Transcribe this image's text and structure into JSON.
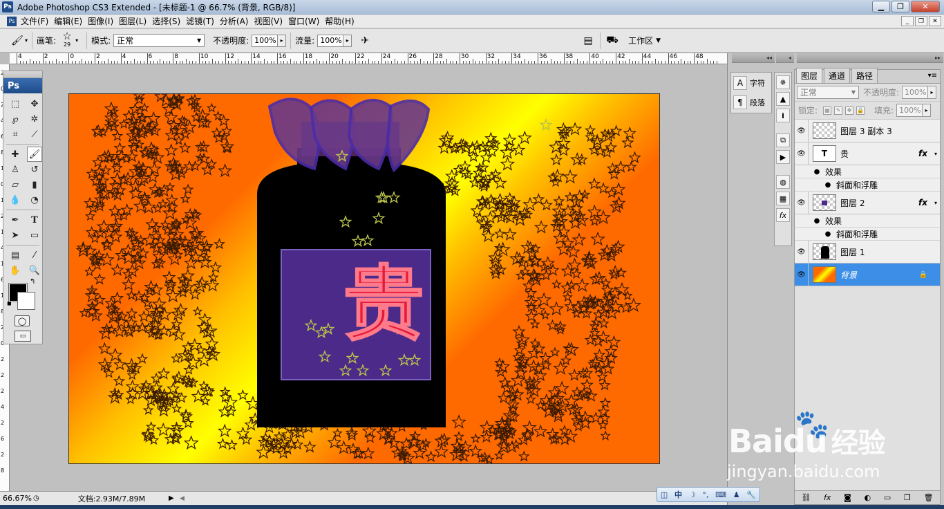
{
  "window": {
    "title": "Adobe Photoshop CS3 Extended - [未标题-1 @ 66.7% (背景, RGB/8)]",
    "app_icon": "Ps"
  },
  "menu": [
    "文件(F)",
    "编辑(E)",
    "图像(I)",
    "图层(L)",
    "选择(S)",
    "滤镜(T)",
    "分析(A)",
    "视图(V)",
    "窗口(W)",
    "帮助(H)"
  ],
  "options": {
    "brush_label": "画笔:",
    "brush_size": "29",
    "mode_label": "模式:",
    "mode_value": "正常",
    "opacity_label": "不透明度:",
    "opacity_value": "100%",
    "flow_label": "流量:",
    "flow_value": "100%",
    "workspace_label": "工作区"
  },
  "ruler": {
    "top_labels": [
      "4",
      "2",
      "0",
      "2",
      "4",
      "6",
      "8",
      "10",
      "12",
      "14",
      "16",
      "18",
      "20",
      "22",
      "24",
      "26",
      "28",
      "30",
      "32",
      "34",
      "36",
      "38",
      "40",
      "42",
      "44",
      "46",
      "48"
    ],
    "left_labels": [
      "2",
      "0",
      "2",
      "4",
      "6",
      "8",
      "1",
      "0",
      "1",
      "2",
      "1",
      "4",
      "1",
      "6",
      "1",
      "8",
      "2",
      "0",
      "2",
      "2",
      "2",
      "4",
      "2",
      "6",
      "2",
      "8"
    ]
  },
  "toolbox": {
    "logo": "Ps",
    "tools": [
      "marquee-icon",
      "move-icon",
      "lasso-icon",
      "magic-wand-icon",
      "crop-icon",
      "slice-icon",
      "healing-icon",
      "brush-icon",
      "stamp-icon",
      "history-brush-icon",
      "eraser-icon",
      "gradient-icon",
      "blur-icon",
      "dodge-icon",
      "pen-icon",
      "type-icon",
      "path-select-icon",
      "shape-icon",
      "notes-icon",
      "eyedropper-icon",
      "hand-icon",
      "zoom-icon"
    ],
    "foreground_color": "#000000",
    "background_color": "#ffffff"
  },
  "canvas": {
    "text_char": "贵"
  },
  "status": {
    "zoom": "66.67%",
    "doc": "文档:2.93M/7.89M"
  },
  "char_panel": {
    "char_label": "字符",
    "para_label": "段落"
  },
  "layers_panel": {
    "tabs": [
      "图层",
      "通道",
      "路径"
    ],
    "blend_mode": "正常",
    "opacity_label": "不透明度:",
    "opacity_value": "100%",
    "lock_label": "锁定:",
    "fill_label": "填充:",
    "fill_value": "100%",
    "layers": [
      {
        "name": "图层 3 副本 3",
        "thumb": "checker"
      },
      {
        "name": "贵",
        "thumb": "text",
        "thumb_text": "T",
        "fx": "fx",
        "effects_label": "效果",
        "effect": "斜面和浮雕"
      },
      {
        "name": "图层 2",
        "thumb": "checker",
        "fx": "fx",
        "effects_label": "效果",
        "effect": "斜面和浮雕"
      },
      {
        "name": "图层 1",
        "thumb": "checker"
      },
      {
        "name": "背景",
        "thumb": "bg",
        "selected": true
      }
    ]
  },
  "ime": {
    "mode": "中"
  },
  "watermark": {
    "brand": "Bai",
    "brand2": "du",
    "cn": "经验",
    "site": "jingyan.baidu.com"
  }
}
